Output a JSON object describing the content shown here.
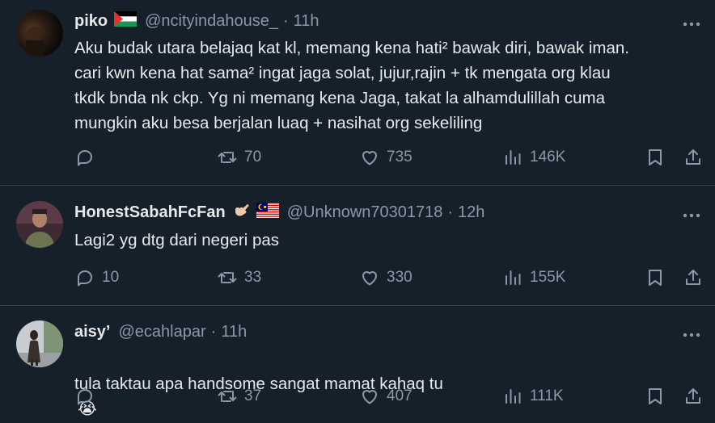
{
  "tweets": [
    {
      "name": "piko",
      "handle": "@ncityindahouse_",
      "time": "11h",
      "text": "Aku budak utara belajaq kat kl, memang kena hati² bawak diri, bawak iman.\ncari kwn kena hat sama² ingat jaga solat, jujur,rajin + tk mengata org klau\ntkdk bnda nk ckp. Yg ni memang kena Jaga, takat la alhamdulillah cuma\nmungkin aku besa berjalan luaq + nasihat org sekeliling",
      "replies": "",
      "retweets": "70",
      "likes": "735",
      "views": "146K"
    },
    {
      "name": "HonestSabahFcFan",
      "handle": "@Unknown70301718",
      "time": "12h",
      "text": "Lagi2 yg dtg dari negeri pas",
      "replies": "10",
      "retweets": "33",
      "likes": "330",
      "views": "155K"
    },
    {
      "name": "aisy’",
      "handle": "@ecahlapar",
      "time": "11h",
      "text": "tula taktau apa handsome sangat mamat kahaq tu",
      "emoji": "😭",
      "replies": "",
      "retweets": "37",
      "likes": "407",
      "views": "111K"
    }
  ],
  "icons": {
    "reply": "reply-icon",
    "retweet": "retweet-icon",
    "like": "heart-icon",
    "views": "views-icon",
    "bookmark": "bookmark-icon",
    "share": "share-icon",
    "more": "more-options-icon"
  },
  "colors": {
    "background": "#15202b",
    "text": "#e7e9ea",
    "muted": "#8b98a5",
    "divider": "#38444d"
  }
}
